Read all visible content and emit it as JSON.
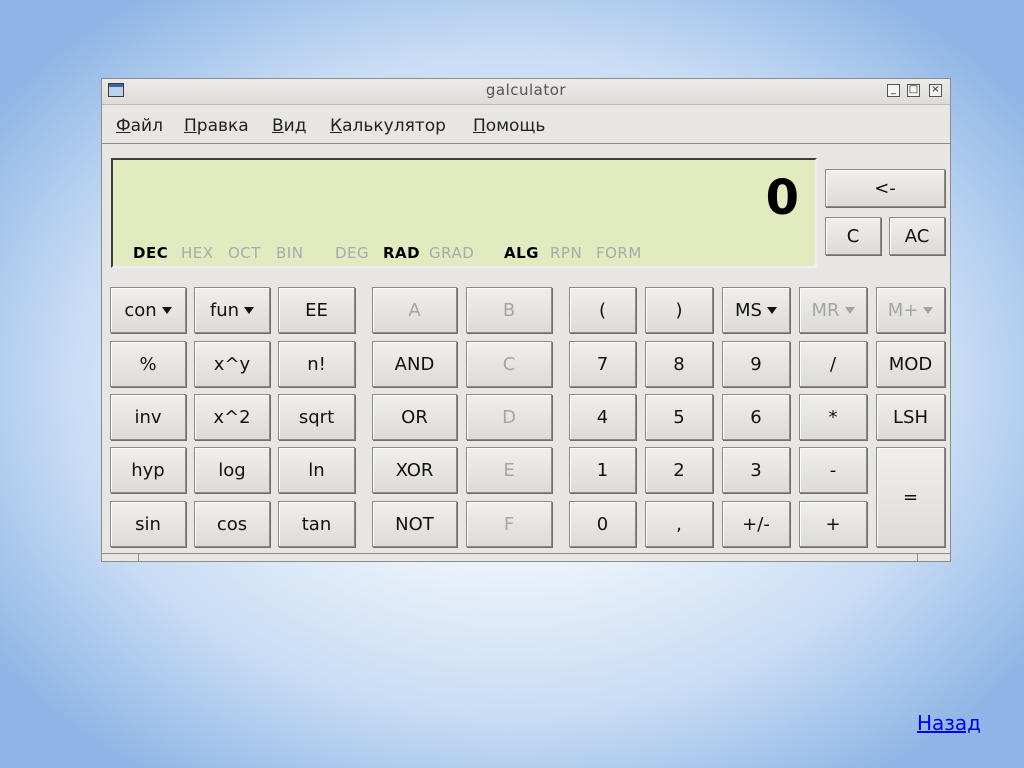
{
  "window": {
    "title": "galculator"
  },
  "menu": [
    "Файл",
    "Правка",
    "Вид",
    "Калькулятор",
    "Помощь"
  ],
  "display": {
    "value": "0",
    "modes": [
      "DEC",
      "HEX",
      "OCT",
      "BIN",
      "DEG",
      "RAD",
      "GRAD",
      "ALG",
      "RPN",
      "FORM"
    ]
  },
  "top_buttons": {
    "backspace": "<-",
    "clear": "C",
    "all_clear": "AC"
  },
  "keypad": {
    "con": "con",
    "fun": "fun",
    "ee": "EE",
    "percent": "%",
    "xpowy": "x^y",
    "fact": "n!",
    "inv": "inv",
    "sq": "x^2",
    "sqrt": "sqrt",
    "hyp": "hyp",
    "log": "log",
    "ln": "ln",
    "sin": "sin",
    "cos": "cos",
    "tan": "tan",
    "A": "A",
    "B": "B",
    "C": "C",
    "D": "D",
    "E": "E",
    "F": "F",
    "and": "AND",
    "or": "OR",
    "xor": "XOR",
    "not": "NOT",
    "lparen": "(",
    "rparen": ")",
    "d7": "7",
    "d8": "8",
    "d9": "9",
    "d4": "4",
    "d5": "5",
    "d6": "6",
    "d1": "1",
    "d2": "2",
    "d3": "3",
    "d0": "0",
    "dot": ",",
    "sign": "+/-",
    "ms": "MS",
    "mr": "MR",
    "mplus": "M+",
    "div": "/",
    "mul": "*",
    "sub": "-",
    "add": "+",
    "mod": "MOD",
    "lsh": "LSH",
    "eq": "="
  },
  "footer": {
    "back_link": "Назад"
  }
}
